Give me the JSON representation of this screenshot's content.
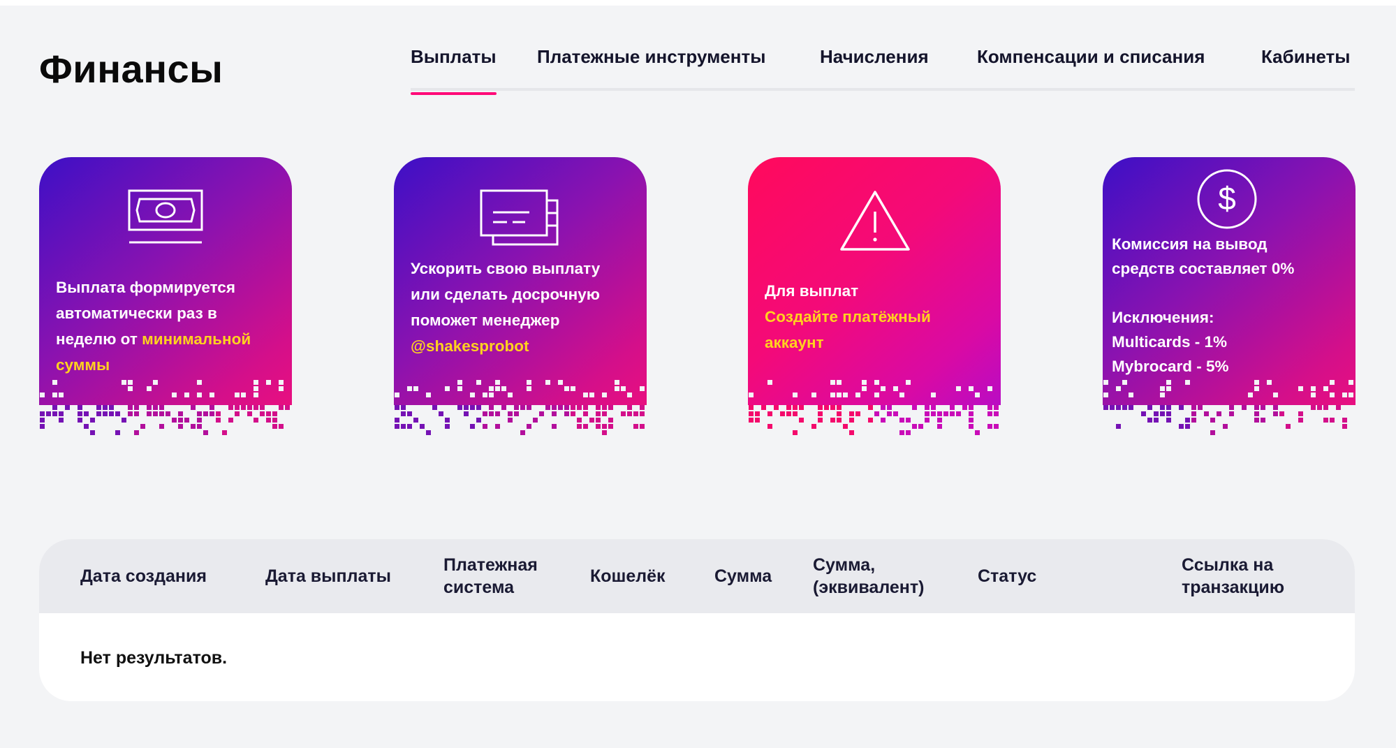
{
  "page": {
    "title": "Финансы"
  },
  "tabs": [
    {
      "label": "Выплаты",
      "active": true
    },
    {
      "label": "Платежные инструменты",
      "active": false
    },
    {
      "label": "Начисления",
      "active": false
    },
    {
      "label": "Компенсации и списания",
      "active": false
    },
    {
      "label": "Кабинеты",
      "active": false
    }
  ],
  "cards": [
    {
      "icon": "banknote-icon",
      "lines": [
        "Выплата формируется",
        "автоматически раз в",
        "неделю от "
      ],
      "highlight": [
        "минимальной",
        "суммы"
      ]
    },
    {
      "icon": "payment-cards-icon",
      "lines": [
        "Ускорить свою выплату",
        "или сделать досрочную",
        "поможет менеджер"
      ],
      "highlight": [
        "@shakesprobot"
      ]
    },
    {
      "icon": "warning-icon",
      "lines": [
        "Для выплат"
      ],
      "highlight": [
        "Создайте платёжный",
        "аккаунт"
      ]
    },
    {
      "icon": "dollar-circle-icon",
      "lines": [
        "Комиссия на вывод",
        "средств составляет 0%",
        "Исключения:",
        "Multicards - 1%",
        "Mybrocard - 5%"
      ],
      "highlight": []
    }
  ],
  "table": {
    "columns": [
      [
        "Дата создания"
      ],
      [
        "Дата выплаты"
      ],
      [
        "Платежная",
        "система"
      ],
      [
        "Кошелёк"
      ],
      [
        "Сумма"
      ],
      [
        "Сумма,",
        "(эквивалент)"
      ],
      [
        "Статус"
      ],
      [
        "Ссылка на",
        "транзакцию"
      ]
    ],
    "empty_message": "Нет результатов."
  },
  "colors": {
    "accent": "#ff0a78",
    "highlight": "#ffd21f",
    "card_purple_start": "#3d10c6",
    "card_pink_start": "#ff0a5c"
  }
}
